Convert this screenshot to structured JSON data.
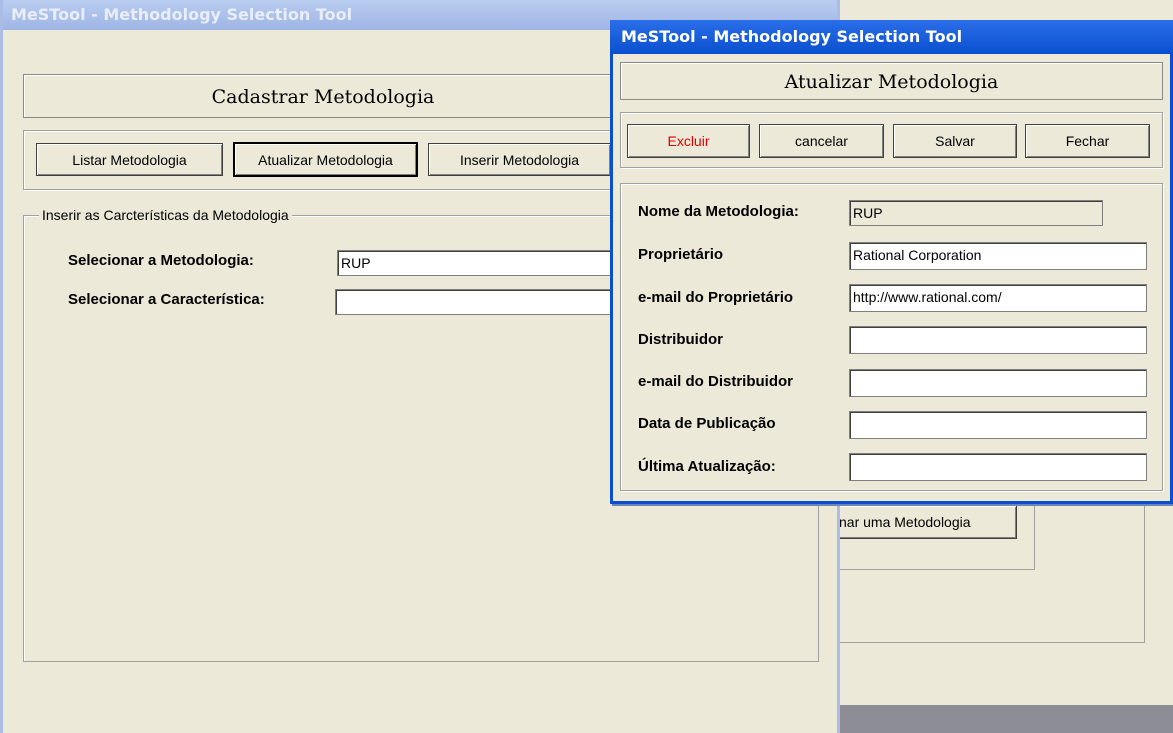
{
  "back_window": {
    "title": "MeSTool - Methodology Selection Tool",
    "heading": "Cadastrar Metodologia",
    "buttons": {
      "listar": "Listar Metodologia",
      "atualizar": "Atualizar Metodologia",
      "inserir": "Inserir Metodologia"
    },
    "group_title": "Inserir as Carcterísticas da Metodologia",
    "fields": {
      "metodologia_label": "Selecionar a Metodologia:",
      "metodologia_value": "RUP",
      "caracteristica_label": "Selecionar a Característica:",
      "caracteristica_value": ""
    }
  },
  "middle_window": {
    "button_partial": "nar uma Metodologia"
  },
  "front_window": {
    "title": "MeSTool - Methodology Selection Tool",
    "heading": "Atualizar Metodologia",
    "buttons": {
      "excluir": "Excluir",
      "cancelar": "cancelar",
      "salvar": "Salvar",
      "fechar": "Fechar"
    },
    "form": [
      {
        "label": "Nome da Metodologia:",
        "value": "RUP"
      },
      {
        "label": "Proprietário",
        "value": "Rational Corporation"
      },
      {
        "label": "e-mail do Proprietário",
        "value": "http://www.rational.com/"
      },
      {
        "label": "Distribuidor",
        "value": ""
      },
      {
        "label": "e-mail do Distribuidor",
        "value": ""
      },
      {
        "label": "Data de Publicação",
        "value": ""
      },
      {
        "label": "Última Atualização:",
        "value": ""
      }
    ]
  },
  "colors": {
    "active_title": "#0a4fd0",
    "inactive_title": "#9fb5e4",
    "dialog_bg": "#ece9d8",
    "danger_text": "#e00000"
  }
}
